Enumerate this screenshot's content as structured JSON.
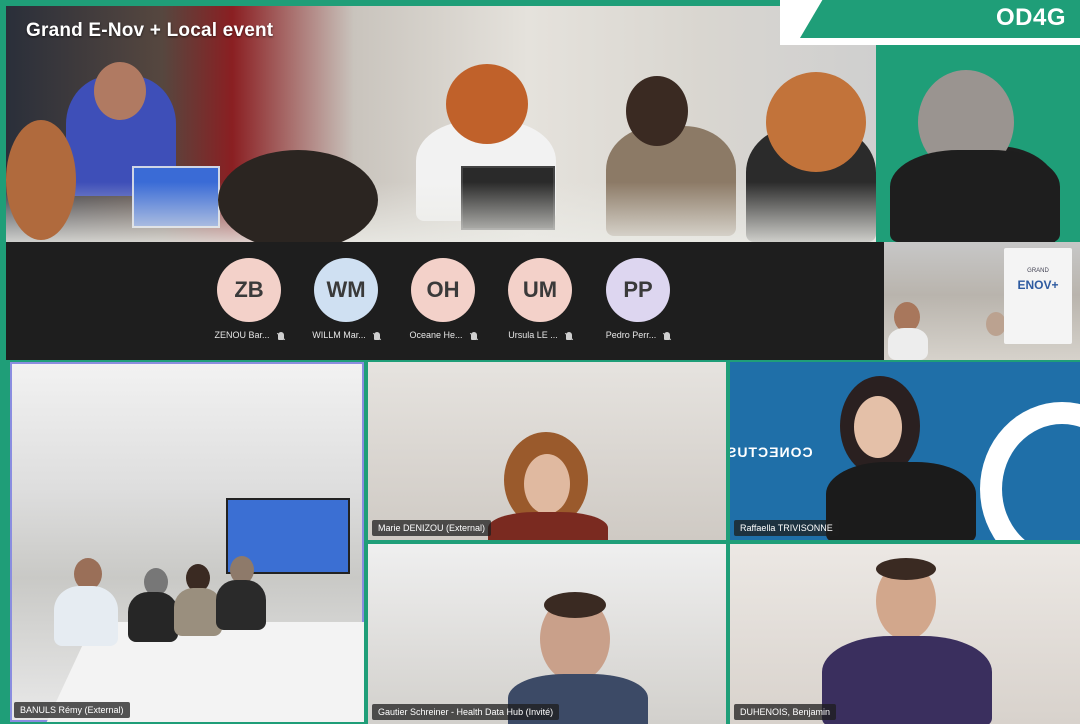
{
  "event_title": "Grand E-Nov + Local event",
  "brand_logo": "OD4G",
  "colors": {
    "brand_green": "#1f9e78",
    "tile_border": "#8a8de0"
  },
  "avatars": [
    {
      "initials": "ZB",
      "label": "ZENOU Bar...",
      "color": "#f3d1c9"
    },
    {
      "initials": "WM",
      "label": "WILLM Mar...",
      "color": "#cfe0f2"
    },
    {
      "initials": "OH",
      "label": "Oceane He...",
      "color": "#f3d1c9"
    },
    {
      "initials": "UM",
      "label": "Ursula LE ...",
      "color": "#f3d1c9"
    },
    {
      "initials": "PP",
      "label": "Pedro Perr...",
      "color": "#ddd6f0"
    }
  ],
  "thumb_sign": {
    "line1": "GRAND",
    "line2": "ENOV+"
  },
  "tiles": {
    "room": "BANULS Rémy (External)",
    "marie": "Marie DENIZOU (External)",
    "raffaella": "Raffaella TRIVISONNE",
    "gautier": "Gautier Schreiner - Health Data Hub (Invité)",
    "benjamin": "DUHENOIS, Benjamin"
  },
  "raff_bg_text": "CONECTUS"
}
